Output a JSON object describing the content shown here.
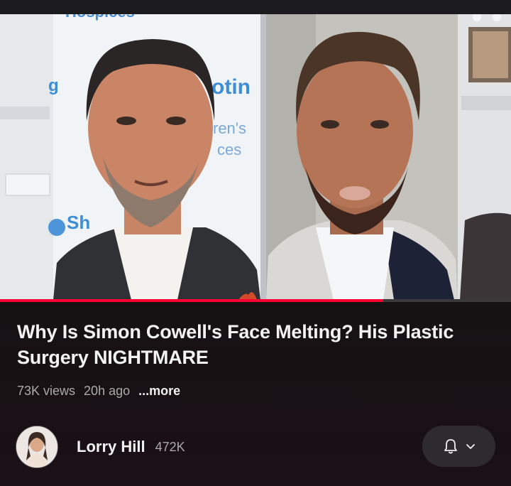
{
  "video": {
    "title": "Why Is Simon Cowell's Face Melting? His Plastic Surgery NIGHTMARE",
    "views": "73K views",
    "age": "20h ago",
    "more_label": "...more",
    "progress": 0.75
  },
  "thumbnail": {
    "backdrop_top_text": "Hospices",
    "backdrop_mid_text_1": "otin",
    "backdrop_mid_text_2": "ren's",
    "backdrop_mid_text_3": "ces",
    "backdrop_low_text": "Sh",
    "backdrop_left_mark": "g"
  },
  "channel": {
    "name": "Lorry Hill",
    "subscribers": "472K"
  },
  "subscribe_control": {
    "bell_icon": "bell-icon",
    "chevron_icon": "chevron-down-icon"
  },
  "colors": {
    "accent": "#ff0033",
    "background": "#141416"
  }
}
